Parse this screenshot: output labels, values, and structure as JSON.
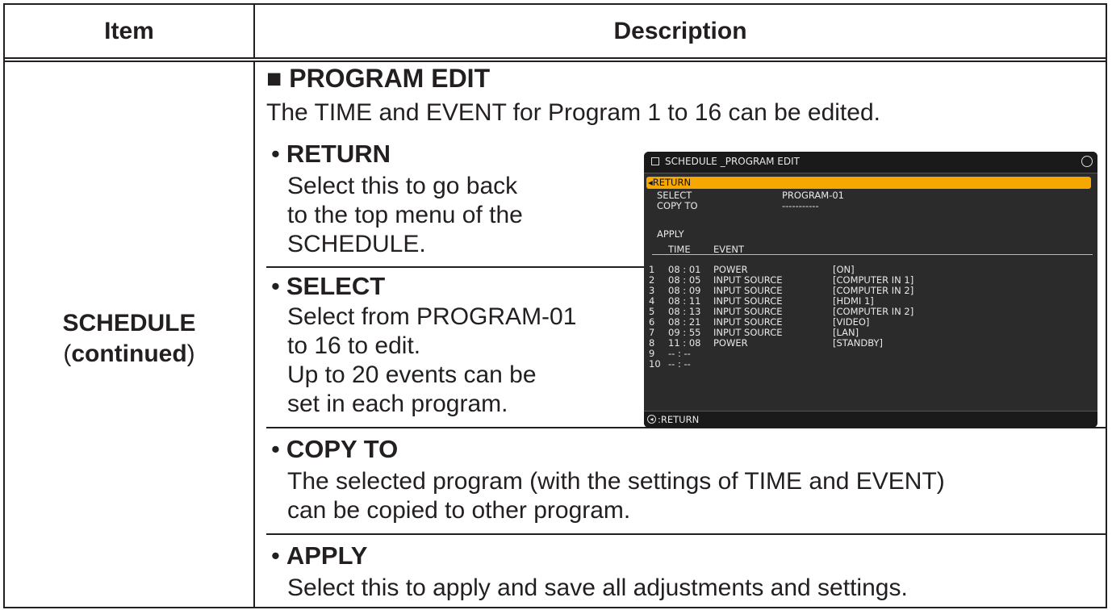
{
  "header": {
    "item": "Item",
    "description": "Description"
  },
  "item": {
    "name": "SCHEDULE",
    "paren_open": "(",
    "continued": "continued",
    "paren_close": ")"
  },
  "section": {
    "title": "■ PROGRAM EDIT",
    "intro": "The TIME and EVENT for Program 1 to 16 can be edited."
  },
  "bullets": [
    {
      "dot": "•",
      "title": "RETURN",
      "lines": [
        "Select this to go back",
        "to the top menu of the",
        "SCHEDULE."
      ]
    },
    {
      "dot": "•",
      "title": "SELECT",
      "lines": [
        "Select from PROGRAM-01",
        "to 16 to edit.",
        "Up to 20 events can be",
        "set in each program."
      ]
    },
    {
      "dot": "•",
      "title": "COPY TO",
      "lines": [
        "The selected program (with the settings of TIME and EVENT)",
        "can be copied to other program."
      ]
    },
    {
      "dot": "•",
      "title": "APPLY",
      "lines": [
        "Select this to apply and save all adjustments and settings."
      ]
    }
  ],
  "screen": {
    "title": "SCHEDULE _PROGRAM EDIT",
    "return_label": "◂RETURN",
    "select_label": "SELECT",
    "select_value": "PROGRAM-01",
    "copy_label": "COPY TO",
    "copy_value": "-----------",
    "apply_label": "APPLY",
    "col_time": "TIME",
    "col_event": "EVENT",
    "events": [
      {
        "num": "1",
        "time": "08 : 01",
        "event": "POWER",
        "source": "[ON]"
      },
      {
        "num": "2",
        "time": "08 : 05",
        "event": "INPUT SOURCE",
        "source": "[COMPUTER IN 1]"
      },
      {
        "num": "3",
        "time": "08 : 09",
        "event": "INPUT SOURCE",
        "source": "[COMPUTER IN 2]"
      },
      {
        "num": "4",
        "time": "08 : 11",
        "event": "INPUT SOURCE",
        "source": "[HDMI 1]"
      },
      {
        "num": "5",
        "time": "08 : 13",
        "event": "INPUT SOURCE",
        "source": "[COMPUTER IN 2]"
      },
      {
        "num": "6",
        "time": "08 : 21",
        "event": "INPUT SOURCE",
        "source": "[VIDEO]"
      },
      {
        "num": "7",
        "time": "09 : 55",
        "event": "INPUT SOURCE",
        "source": "[LAN]"
      },
      {
        "num": "8",
        "time": "11 : 08",
        "event": "POWER",
        "source": "[STANDBY]"
      },
      {
        "num": "9",
        "time": "-- : --",
        "event": "",
        "source": ""
      },
      {
        "num": "10",
        "time": "-- : --",
        "event": "",
        "source": ""
      }
    ],
    "footer": ":RETURN",
    "footer_icon": "◂"
  }
}
